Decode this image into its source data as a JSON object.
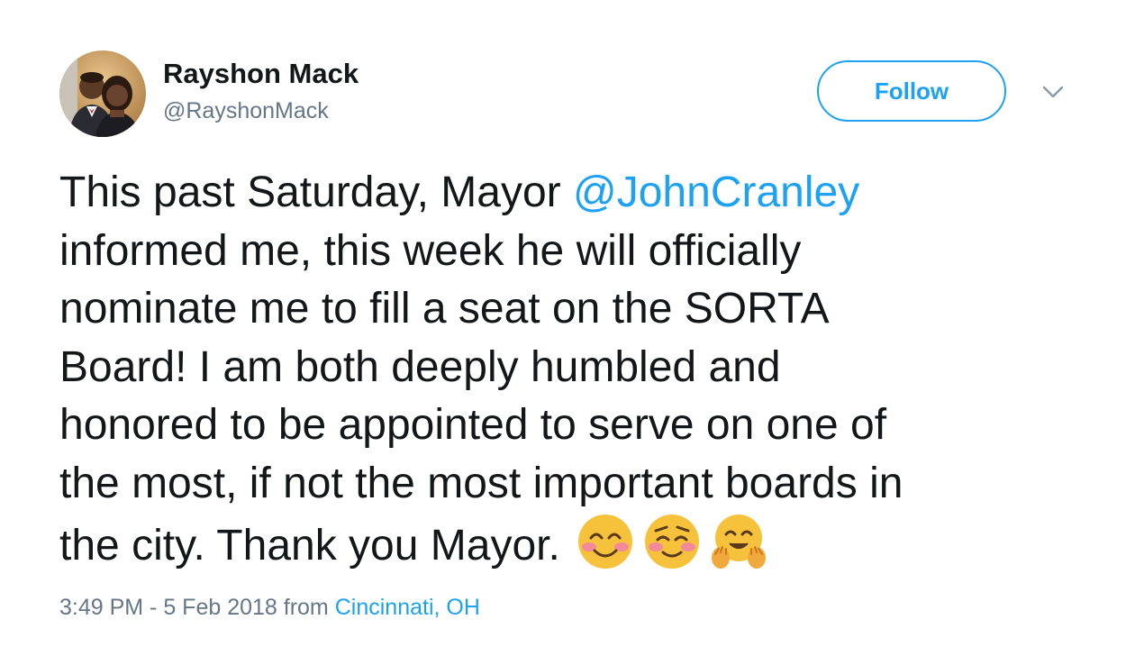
{
  "author": {
    "display_name": "Rayshon Mack",
    "handle": "@RayshonMack",
    "avatar_icon": "profile-photo-couple"
  },
  "follow_button": {
    "label": "Follow",
    "accent_color": "#1da1f2"
  },
  "menu": {
    "icon": "chevron-down-icon"
  },
  "tweet": {
    "lines": [
      {
        "before": "This past Saturday, Mayor ",
        "mention": "@JohnCranley"
      },
      {
        "text": "informed me, this week he will officially"
      },
      {
        "text": "nominate me to fill a seat on the SORTA"
      },
      {
        "text": "Board! I am both deeply humbled and"
      },
      {
        "text": "honored to be appointed to serve on one of"
      },
      {
        "text": "the most, if not the most important boards in"
      },
      {
        "text": "the city. Thank you Mayor."
      }
    ],
    "emojis": [
      "smiling-face-with-smiling-eyes-emoji",
      "relieved-blushing-face-emoji",
      "hugging-face-emoji"
    ]
  },
  "meta": {
    "time": "3:49 PM - 5 Feb 2018",
    "from_label": " from ",
    "location": "Cincinnati, OH"
  }
}
